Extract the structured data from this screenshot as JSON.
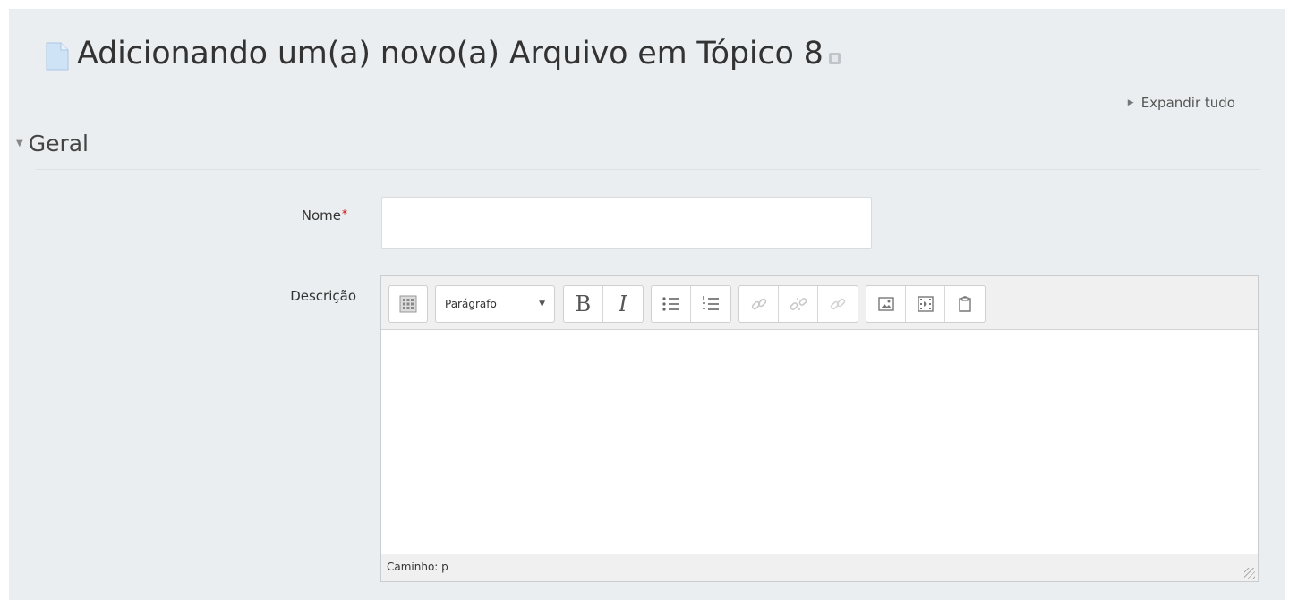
{
  "page": {
    "title": "Adicionando um(a) novo(a) Arquivo em Tópico 8",
    "expand_all": "Expandir tudo"
  },
  "section": {
    "title": "Geral"
  },
  "form": {
    "name_label": "Nome",
    "required_mark": "*",
    "name_value": "",
    "description_label": "Descrição"
  },
  "editor": {
    "format_select_value": "Parágrafo",
    "bold_label": "B",
    "italic_label": "I",
    "path_text": "Caminho: p",
    "toolbar_icons": [
      "toolbar-toggle-icon",
      "unordered-list-icon",
      "ordered-list-icon",
      "link-icon",
      "unlink-icon",
      "anchor-icon",
      "image-icon",
      "media-icon",
      "manage-files-icon"
    ]
  },
  "colors": {
    "page_background": "#ebeef0",
    "required_asterisk": "#cc0000",
    "text": "#333333"
  }
}
